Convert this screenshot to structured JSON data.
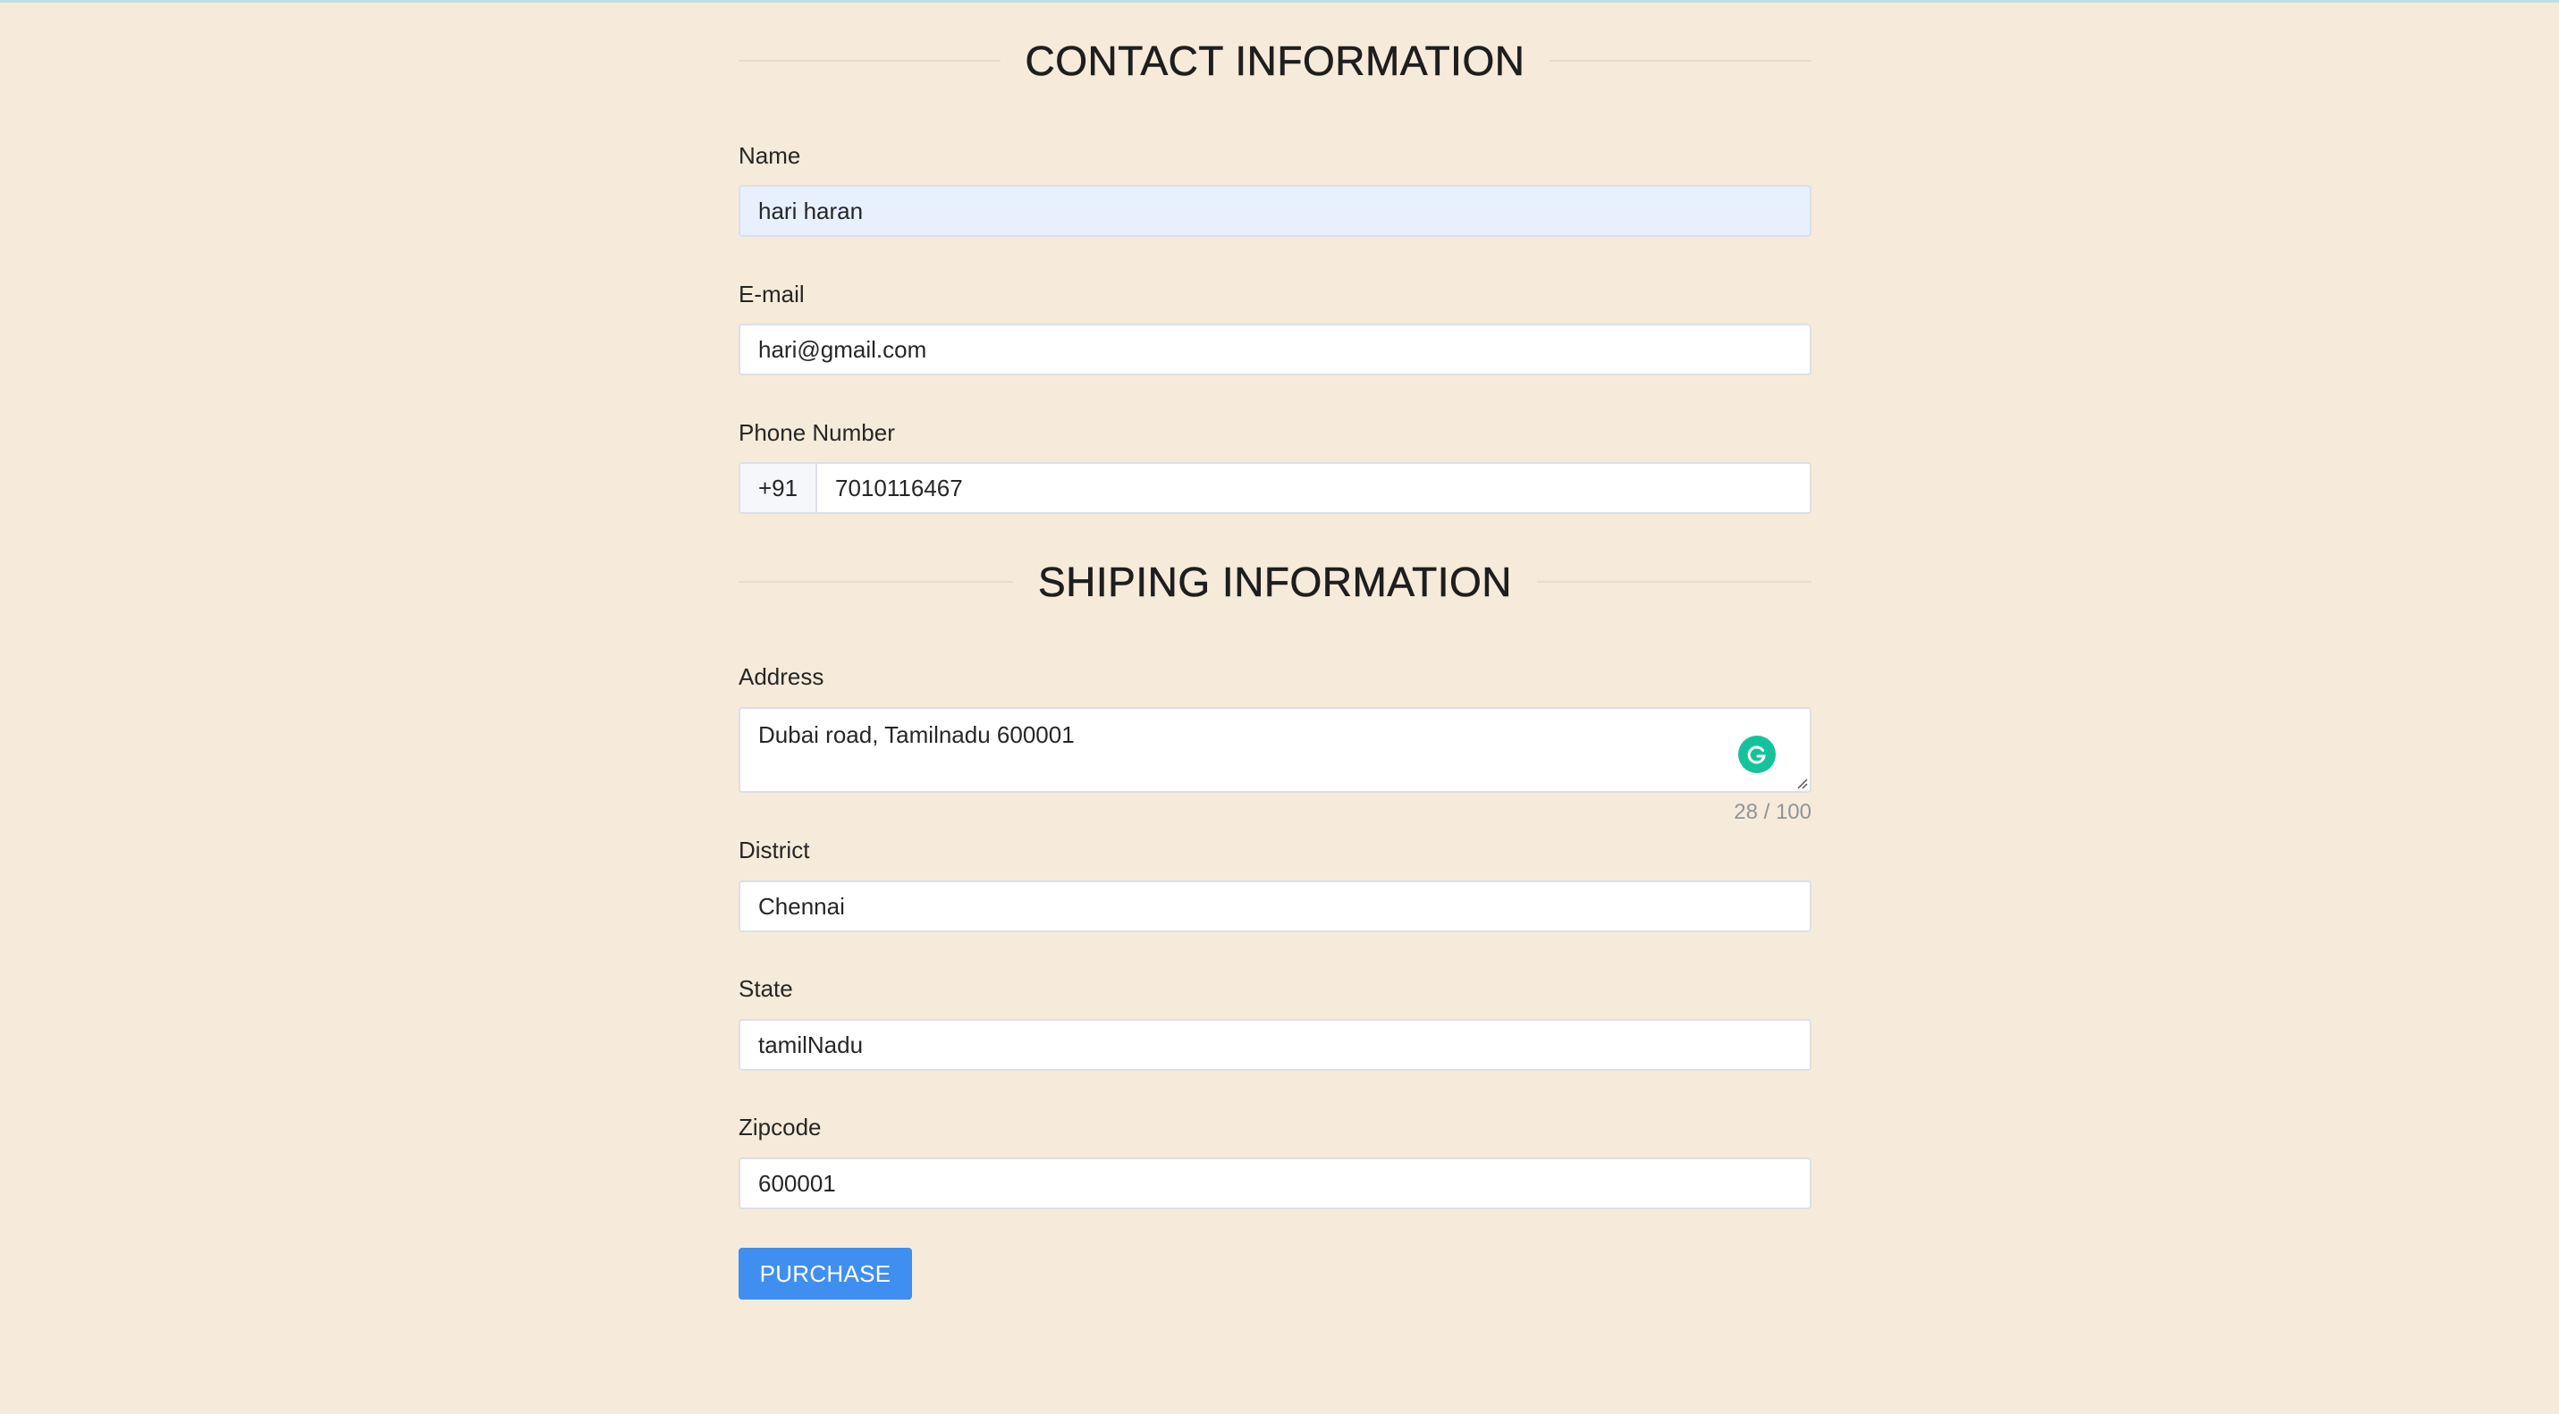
{
  "contact": {
    "heading": "CONTACT INFORMATION",
    "name_label": "Name",
    "name_value": "hari haran",
    "email_label": "E-mail",
    "email_value": "hari@gmail.com",
    "phone_label": "Phone Number",
    "phone_prefix": "+91",
    "phone_value": "7010116467"
  },
  "shipping": {
    "heading": "SHIPING INFORMATION",
    "address_label": "Address",
    "address_value": "Dubai road, Tamilnadu 600001",
    "address_counter": "28 / 100",
    "district_label": "District",
    "district_value": "Chennai",
    "state_label": "State",
    "state_value": "tamilNadu",
    "zipcode_label": "Zipcode",
    "zipcode_value": "600001"
  },
  "actions": {
    "purchase_label": "PURCHASE"
  },
  "icons": {
    "grammarly": "grammarly-icon"
  },
  "colors": {
    "background": "#f6ebda",
    "accent": "#3f8ff0",
    "autofill": "#e8f0fe",
    "grammarly": "#15c39a"
  }
}
